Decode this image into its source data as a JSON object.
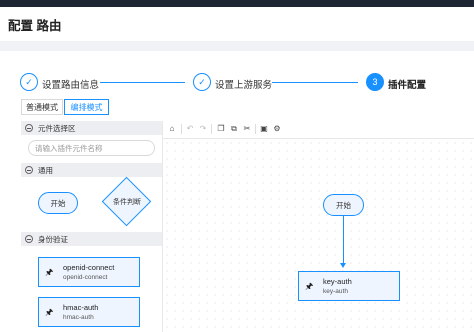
{
  "page": {
    "title": "配置 路由"
  },
  "steps": [
    {
      "index": "✓",
      "label": "设置路由信息",
      "state": "done"
    },
    {
      "index": "✓",
      "label": "设置上游服务",
      "state": "done"
    },
    {
      "index": "3",
      "label": "插件配置",
      "state": "active"
    }
  ],
  "modes": [
    {
      "label": "普通模式",
      "active": false
    },
    {
      "label": "编排模式",
      "active": true
    }
  ],
  "palette": {
    "header": "元件选择区",
    "search_placeholder": "请输入插件元件名称",
    "general": {
      "label": "通用",
      "start": "开始",
      "condition": "条件判断"
    },
    "auth": {
      "label": "身份验证",
      "plugins": [
        {
          "name": "openid-connect",
          "sub": "openid-connect"
        },
        {
          "name": "hmac-auth",
          "sub": "hmac-auth"
        }
      ]
    }
  },
  "toolbar": {
    "icons": [
      "save-icon",
      "undo-icon",
      "redo-icon",
      "copy-icon",
      "paste-icon",
      "delete-icon",
      "image-icon",
      "settings-icon"
    ]
  },
  "canvas": {
    "start_node": "开始",
    "plugin_node": {
      "name": "key-auth",
      "sub": "key-auth"
    }
  },
  "colors": {
    "accent": "#1890ff",
    "node_fill": "#eef5ff",
    "topbar": "#1f2633"
  }
}
